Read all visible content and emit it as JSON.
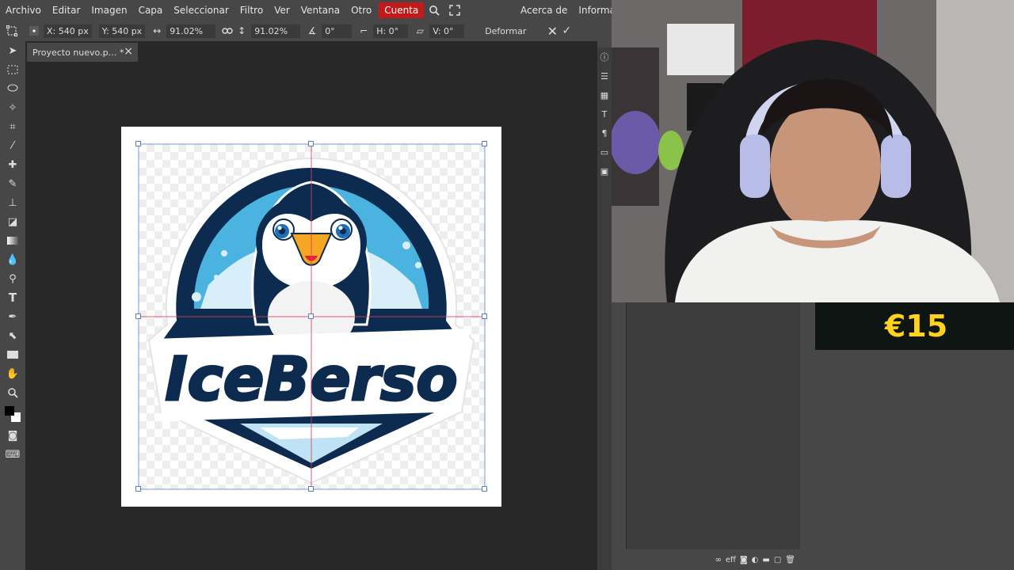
{
  "menu": {
    "items": [
      "Archivo",
      "Editar",
      "Imagen",
      "Capa",
      "Seleccionar",
      "Filtro",
      "Ver",
      "Ventana",
      "Otro"
    ],
    "account": "Cuenta",
    "right_items": [
      "Acerca de",
      "Informar u"
    ]
  },
  "options": {
    "x": "X: 540 px",
    "y": "Y: 540 px",
    "w": "91.02%",
    "h": "91.02%",
    "angle": "0°",
    "skew_h": "H: 0°",
    "skew_v": "V: 0°",
    "warp": "Deformar"
  },
  "tab": {
    "title": "Proyecto nuevo.p… *"
  },
  "logo": {
    "brand": "IceBerso"
  },
  "overlay": {
    "price": "€15"
  },
  "layer_tools": {
    "eff": "eff"
  },
  "colors": {
    "menu_bg": "#474747",
    "workspace_bg": "#282828",
    "account_red": "#c21a1a",
    "penguin_navy": "#0d2a4f",
    "ice_blue": "#4bb3e0",
    "price_yellow": "#ffd21f"
  }
}
